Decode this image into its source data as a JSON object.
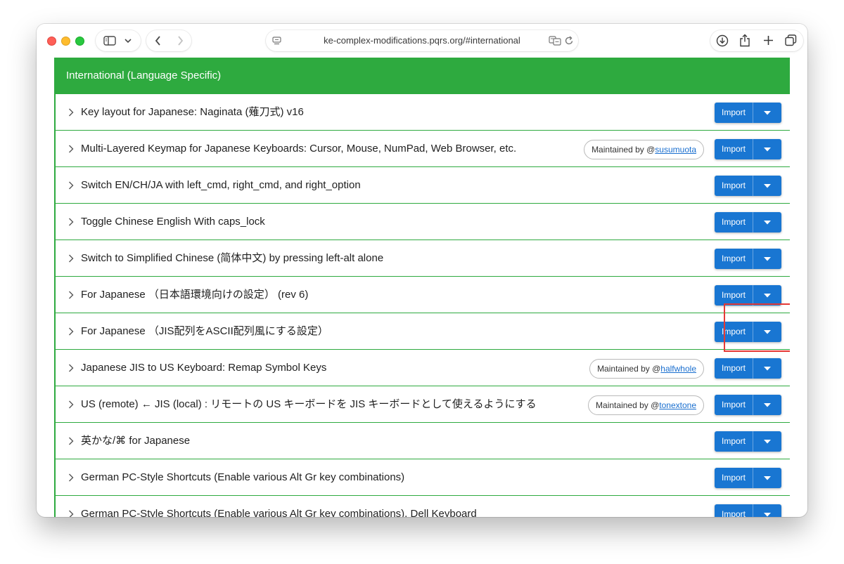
{
  "browser": {
    "url": "ke-complex-modifications.pqrs.org/#international"
  },
  "section": {
    "title": "International (Language Specific)"
  },
  "rows": [
    {
      "title": "Key layout for Japanese: Naginata (薙刀式) v16",
      "maintained_prefix": "",
      "maintainer": "",
      "button": "Import"
    },
    {
      "title": "Multi-Layered Keymap for Japanese Keyboards: Cursor, Mouse, NumPad, Web Browser, etc.",
      "maintained_prefix": "Maintained by @",
      "maintainer": "susumuota",
      "button": "Import"
    },
    {
      "title": "Switch EN/CH/JA with left_cmd, right_cmd, and right_option",
      "maintained_prefix": "",
      "maintainer": "",
      "button": "Import"
    },
    {
      "title": "Toggle Chinese English With caps_lock",
      "maintained_prefix": "",
      "maintainer": "",
      "button": "Import"
    },
    {
      "title": "Switch to Simplified Chinese (简体中文) by pressing left-alt alone",
      "maintained_prefix": "",
      "maintainer": "",
      "button": "Import"
    },
    {
      "title": "For Japanese （日本語環境向けの設定） (rev 6)",
      "maintained_prefix": "",
      "maintainer": "",
      "button": "Import"
    },
    {
      "title": "For Japanese （JIS配列をASCII配列風にする設定）",
      "maintained_prefix": "",
      "maintainer": "",
      "button": "Import"
    },
    {
      "title": "Japanese JIS to US Keyboard: Remap Symbol Keys",
      "maintained_prefix": "Maintained by @",
      "maintainer": "halfwhole",
      "button": "Import"
    },
    {
      "title": "US (remote) ← JIS (local) : リモートの US キーボードを JIS キーボードとして使えるようにする",
      "maintained_prefix": "Maintained by @",
      "maintainer": "tonextone",
      "button": "Import"
    },
    {
      "title": "英かな/⌘ for Japanese",
      "maintained_prefix": "",
      "maintainer": "",
      "button": "Import"
    },
    {
      "title": "German PC-Style Shortcuts (Enable various Alt Gr key combinations)",
      "maintained_prefix": "",
      "maintainer": "",
      "button": "Import"
    },
    {
      "title": "German PC-Style Shortcuts (Enable various Alt Gr key combinations), Dell Keyboard",
      "maintained_prefix": "",
      "maintainer": "",
      "button": "Import"
    }
  ],
  "highlighted_row_index": 5,
  "colors": {
    "header_green": "#2eaa3f",
    "button_blue": "#1976d2",
    "highlight_red": "#e53935"
  },
  "icons": {
    "sidebar": "sidebar-icon",
    "back": "chevron-left-icon",
    "forward": "chevron-right-icon",
    "download": "download-icon",
    "share": "share-icon",
    "new_tab": "plus-icon",
    "tabs": "tab-overview-icon"
  }
}
